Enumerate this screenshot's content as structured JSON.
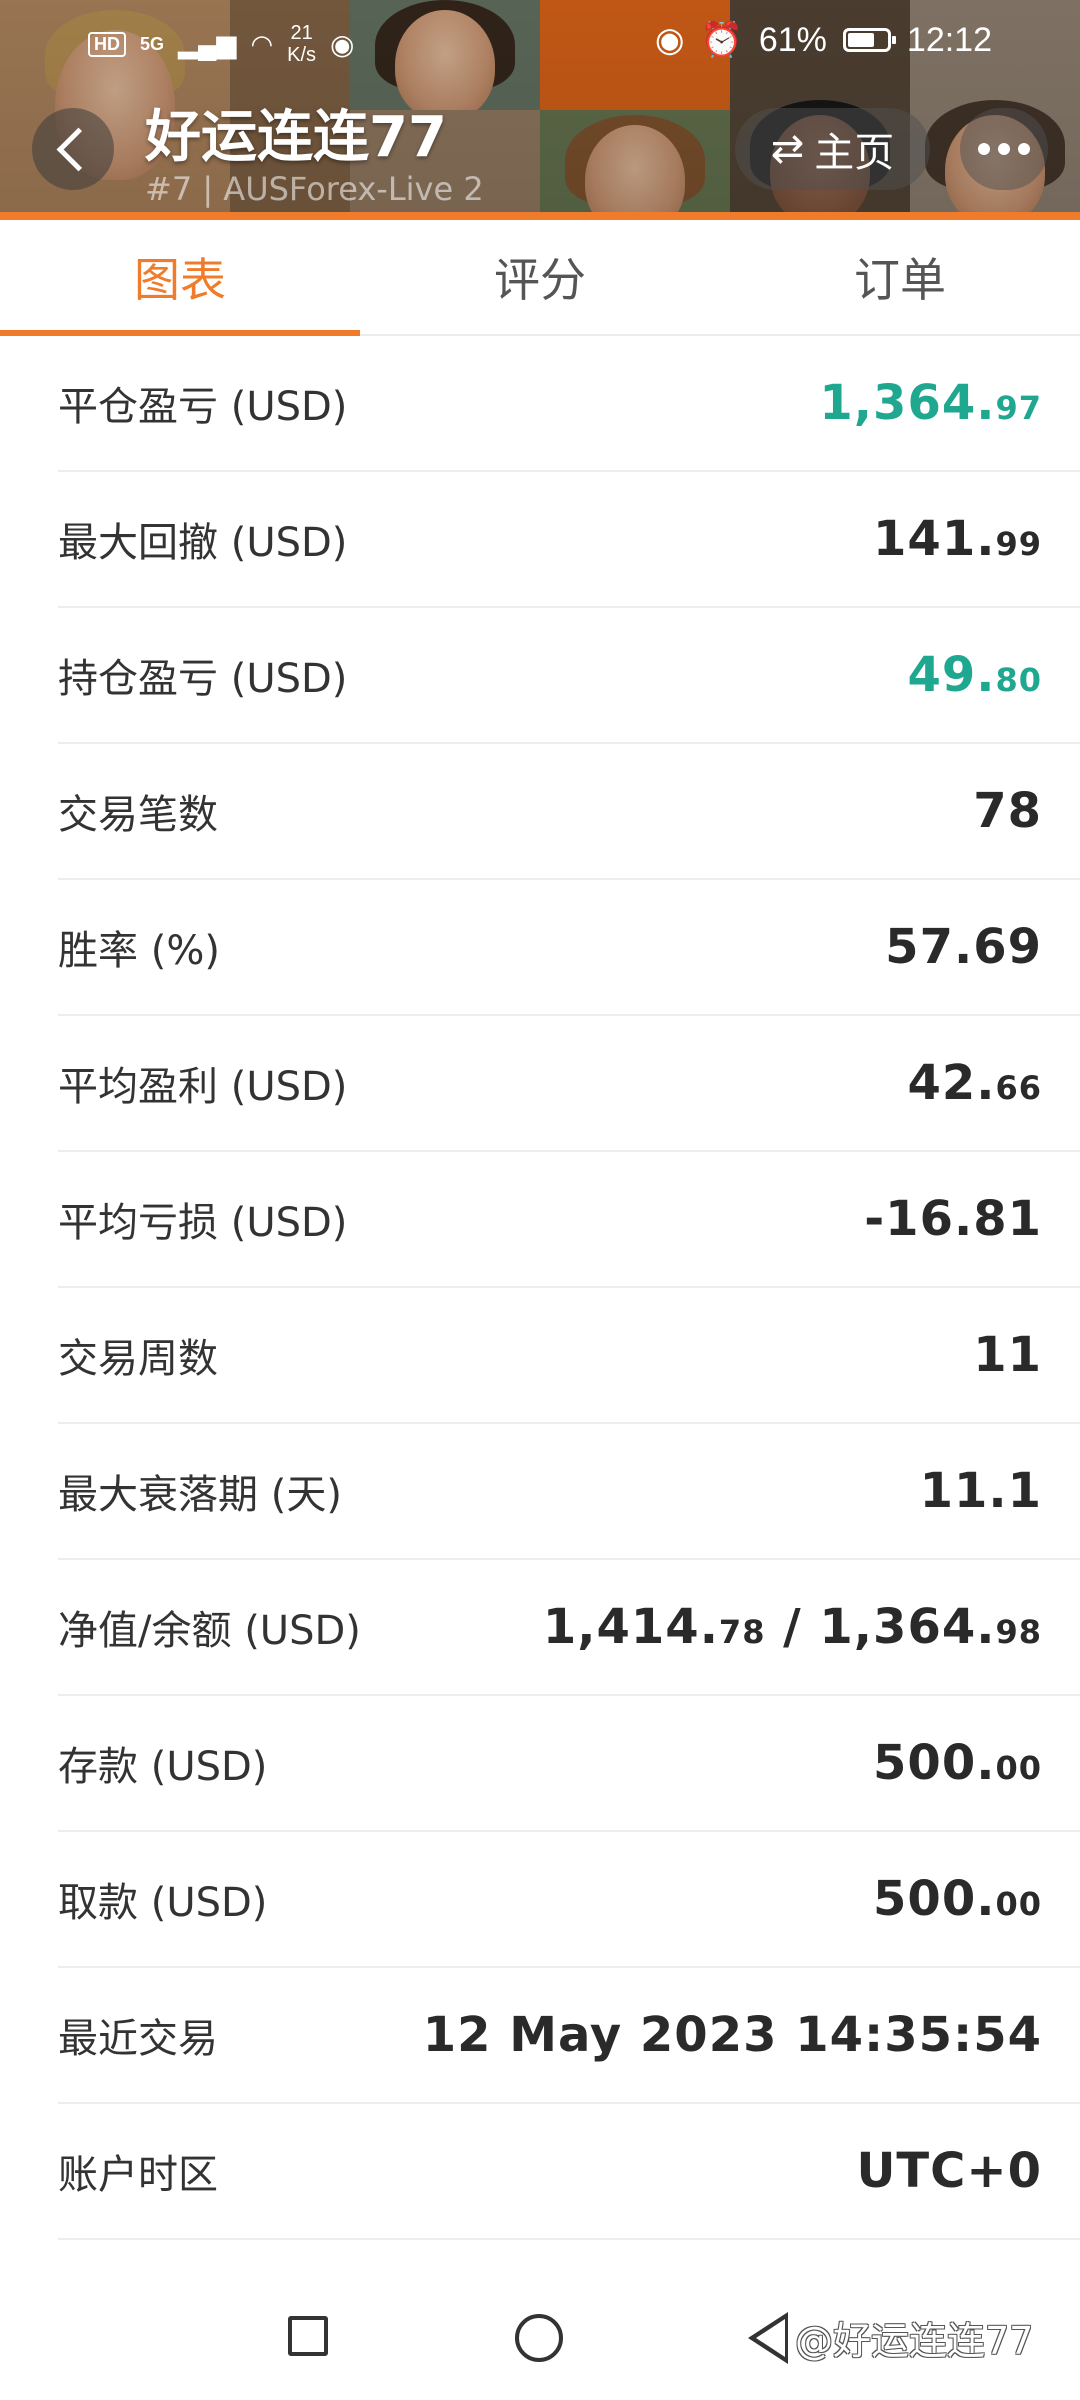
{
  "statusbar": {
    "hd": "HD",
    "network": "5G",
    "speed_top": "21",
    "speed_bottom": "K/s",
    "battery": "61%",
    "time": "12:12"
  },
  "header": {
    "title": "好运连连77",
    "subtitle": "#7 | AUSForex-Live 2",
    "home_label": "主页"
  },
  "tabs": [
    {
      "label": "图表",
      "active": true
    },
    {
      "label": "评分",
      "active": false
    },
    {
      "label": "订单",
      "active": false
    }
  ],
  "stats": [
    {
      "label": "平仓盈亏 (USD)",
      "int": "1,364.",
      "dec": "97",
      "color": "#1fa88f"
    },
    {
      "label": "最大回撤 (USD)",
      "int": "141.",
      "dec": "99"
    },
    {
      "label": "持仓盈亏 (USD)",
      "int": "49.",
      "dec": "80",
      "color": "#1fa88f"
    },
    {
      "label": "交易笔数",
      "int": "78",
      "dec": ""
    },
    {
      "label": "胜率 (%)",
      "int": "57.69",
      "dec": ""
    },
    {
      "label": "平均盈利 (USD)",
      "int": "42.",
      "dec": "66"
    },
    {
      "label": "平均亏损 (USD)",
      "int": "-16.81",
      "dec": ""
    },
    {
      "label": "交易周数",
      "int": "11",
      "dec": ""
    },
    {
      "label": "最大衰落期 (天)",
      "int": "11.1",
      "dec": ""
    },
    {
      "label": "净值/余额 (USD)",
      "int": "1,414.",
      "dec": "78",
      "int2": " / 1,364.",
      "dec2": "98"
    },
    {
      "label": "存款 (USD)",
      "int": "500.",
      "dec": "00"
    },
    {
      "label": "取款 (USD)",
      "int": "500.",
      "dec": "00"
    },
    {
      "label": "最近交易",
      "int": "12 May 2023 14:35:54",
      "dec": ""
    },
    {
      "label": "账户时区",
      "int": "UTC+0",
      "dec": ""
    }
  ],
  "watermark": "@好运连连77",
  "colors": {
    "accent": "#f07c2b",
    "positive": "#1fa88f"
  }
}
